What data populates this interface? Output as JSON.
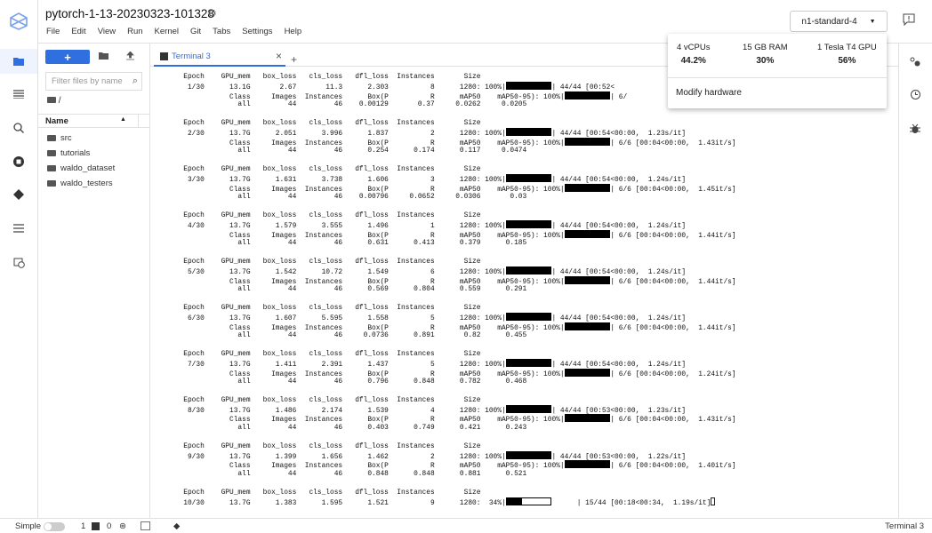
{
  "app": {
    "title": "pytorch-1-13-20230323-101328",
    "menu": [
      "File",
      "Edit",
      "View",
      "Run",
      "Kernel",
      "Git",
      "Tabs",
      "Settings",
      "Help"
    ],
    "accent": "#2f6fe0"
  },
  "hardware": {
    "button_label": "n1-standard-4",
    "popup": {
      "cpu_label": "4 vCPUs",
      "cpu_value": "44.2%",
      "ram_label": "15 GB RAM",
      "ram_value": "30%",
      "gpu_label": "1 Tesla T4 GPU",
      "gpu_value": "56%",
      "modify_label": "Modify hardware"
    }
  },
  "activity_bar": [
    "folder-icon",
    "table-of-contents-icon",
    "search-icon",
    "stop-circle-icon",
    "git-icon",
    "list-icon",
    "schedule-icon"
  ],
  "file_browser": {
    "new_label": "+",
    "filter_placeholder": "Filter files by name",
    "path": "/",
    "name_header": "Name",
    "files": [
      "src",
      "tutorials",
      "waldo_dataset",
      "waldo_testers"
    ]
  },
  "tab": {
    "label": "Terminal 3",
    "add": "+"
  },
  "terminal": {
    "train_headers": [
      "Epoch",
      "GPU_mem",
      "box_loss",
      "cls_loss",
      "dfl_loss",
      "Instances",
      "Size"
    ],
    "val_headers": [
      "Class",
      "Images",
      "Instances",
      "Box(P",
      "R",
      "mAP50",
      "mAP50-95): "
    ],
    "epochs": [
      {
        "epoch": "1/30",
        "gpu_mem": "13.1G",
        "box_loss": "2.67",
        "cls_loss": "11.3",
        "dfl_loss": "2.303",
        "instances": "8",
        "size": "1280",
        "train_pct": "100%",
        "train_fill": 1,
        "train_progress": "44/44 [00:52<",
        "val": [
          "all",
          "44",
          "46",
          "0.00129",
          "0.37",
          "0.0262",
          "0.0205"
        ],
        "val_pct": "100%",
        "val_fill": 1,
        "val_progress": "6/"
      },
      {
        "epoch": "2/30",
        "gpu_mem": "13.7G",
        "box_loss": "2.051",
        "cls_loss": "3.996",
        "dfl_loss": "1.837",
        "instances": "2",
        "size": "1280",
        "train_pct": "100%",
        "train_fill": 1,
        "train_progress": "44/44 [00:54<00:00,  1.23s/it]",
        "val": [
          "all",
          "44",
          "46",
          "0.254",
          "0.174",
          "0.117",
          "0.0474"
        ],
        "val_pct": "100%",
        "val_fill": 1,
        "val_progress": "6/6 [00:04<00:00,  1.43it/s]"
      },
      {
        "epoch": "3/30",
        "gpu_mem": "13.7G",
        "box_loss": "1.631",
        "cls_loss": "3.738",
        "dfl_loss": "1.606",
        "instances": "3",
        "size": "1280",
        "train_pct": "100%",
        "train_fill": 1,
        "train_progress": "44/44 [00:54<00:00,  1.24s/it]",
        "val": [
          "all",
          "44",
          "46",
          "0.00796",
          "0.0652",
          "0.0306",
          "0.03"
        ],
        "val_pct": "100%",
        "val_fill": 1,
        "val_progress": "6/6 [00:04<00:00,  1.45it/s]"
      },
      {
        "epoch": "4/30",
        "gpu_mem": "13.7G",
        "box_loss": "1.579",
        "cls_loss": "3.555",
        "dfl_loss": "1.496",
        "instances": "1",
        "size": "1280",
        "train_pct": "100%",
        "train_fill": 1,
        "train_progress": "44/44 [00:54<00:00,  1.24s/it]",
        "val": [
          "all",
          "44",
          "46",
          "0.631",
          "0.413",
          "0.379",
          "0.185"
        ],
        "val_pct": "100%",
        "val_fill": 1,
        "val_progress": "6/6 [00:04<00:00,  1.44it/s]"
      },
      {
        "epoch": "5/30",
        "gpu_mem": "13.7G",
        "box_loss": "1.542",
        "cls_loss": "10.72",
        "dfl_loss": "1.549",
        "instances": "6",
        "size": "1280",
        "train_pct": "100%",
        "train_fill": 1,
        "train_progress": "44/44 [00:54<00:00,  1.24s/it]",
        "val": [
          "all",
          "44",
          "46",
          "0.569",
          "0.804",
          "0.559",
          "0.291"
        ],
        "val_pct": "100%",
        "val_fill": 1,
        "val_progress": "6/6 [00:04<00:00,  1.44it/s]"
      },
      {
        "epoch": "6/30",
        "gpu_mem": "13.7G",
        "box_loss": "1.607",
        "cls_loss": "5.595",
        "dfl_loss": "1.558",
        "instances": "5",
        "size": "1280",
        "train_pct": "100%",
        "train_fill": 1,
        "train_progress": "44/44 [00:54<00:00,  1.24s/it]",
        "val": [
          "all",
          "44",
          "46",
          "0.0736",
          "0.891",
          "0.82",
          "0.455"
        ],
        "val_pct": "100%",
        "val_fill": 1,
        "val_progress": "6/6 [00:04<00:00,  1.44it/s]"
      },
      {
        "epoch": "7/30",
        "gpu_mem": "13.7G",
        "box_loss": "1.411",
        "cls_loss": "2.391",
        "dfl_loss": "1.437",
        "instances": "5",
        "size": "1280",
        "train_pct": "100%",
        "train_fill": 1,
        "train_progress": "44/44 [00:54<00:00,  1.24s/it]",
        "val": [
          "all",
          "44",
          "46",
          "0.796",
          "0.848",
          "0.782",
          "0.468"
        ],
        "val_pct": "100%",
        "val_fill": 1,
        "val_progress": "6/6 [00:04<00:00,  1.24it/s]"
      },
      {
        "epoch": "8/30",
        "gpu_mem": "13.7G",
        "box_loss": "1.486",
        "cls_loss": "2.174",
        "dfl_loss": "1.539",
        "instances": "4",
        "size": "1280",
        "train_pct": "100%",
        "train_fill": 1,
        "train_progress": "44/44 [00:53<00:00,  1.23s/it]",
        "val": [
          "all",
          "44",
          "46",
          "0.403",
          "0.749",
          "0.421",
          "0.243"
        ],
        "val_pct": "100%",
        "val_fill": 1,
        "val_progress": "6/6 [00:04<00:00,  1.43it/s]"
      },
      {
        "epoch": "9/30",
        "gpu_mem": "13.7G",
        "box_loss": "1.399",
        "cls_loss": "1.656",
        "dfl_loss": "1.462",
        "instances": "2",
        "size": "1280",
        "train_pct": "100%",
        "train_fill": 1,
        "train_progress": "44/44 [00:53<00:00,  1.22s/it]",
        "val": [
          "all",
          "44",
          "46",
          "0.848",
          "0.848",
          "0.881",
          "0.521"
        ],
        "val_pct": "100%",
        "val_fill": 1,
        "val_progress": "6/6 [00:04<00:00,  1.40it/s]"
      },
      {
        "epoch": "10/30",
        "gpu_mem": "13.7G",
        "box_loss": "1.383",
        "cls_loss": "1.595",
        "dfl_loss": "1.521",
        "instances": "9",
        "size": "1280",
        "train_pct": " 34%",
        "train_fill": 0.34,
        "train_progress": "15/44 [00:18<00:34,  1.19s/it]",
        "val": null
      }
    ]
  },
  "status_bar": {
    "mode_label": "Simple",
    "kernels": "1",
    "terminals": "0",
    "right_label": "Terminal 3"
  }
}
